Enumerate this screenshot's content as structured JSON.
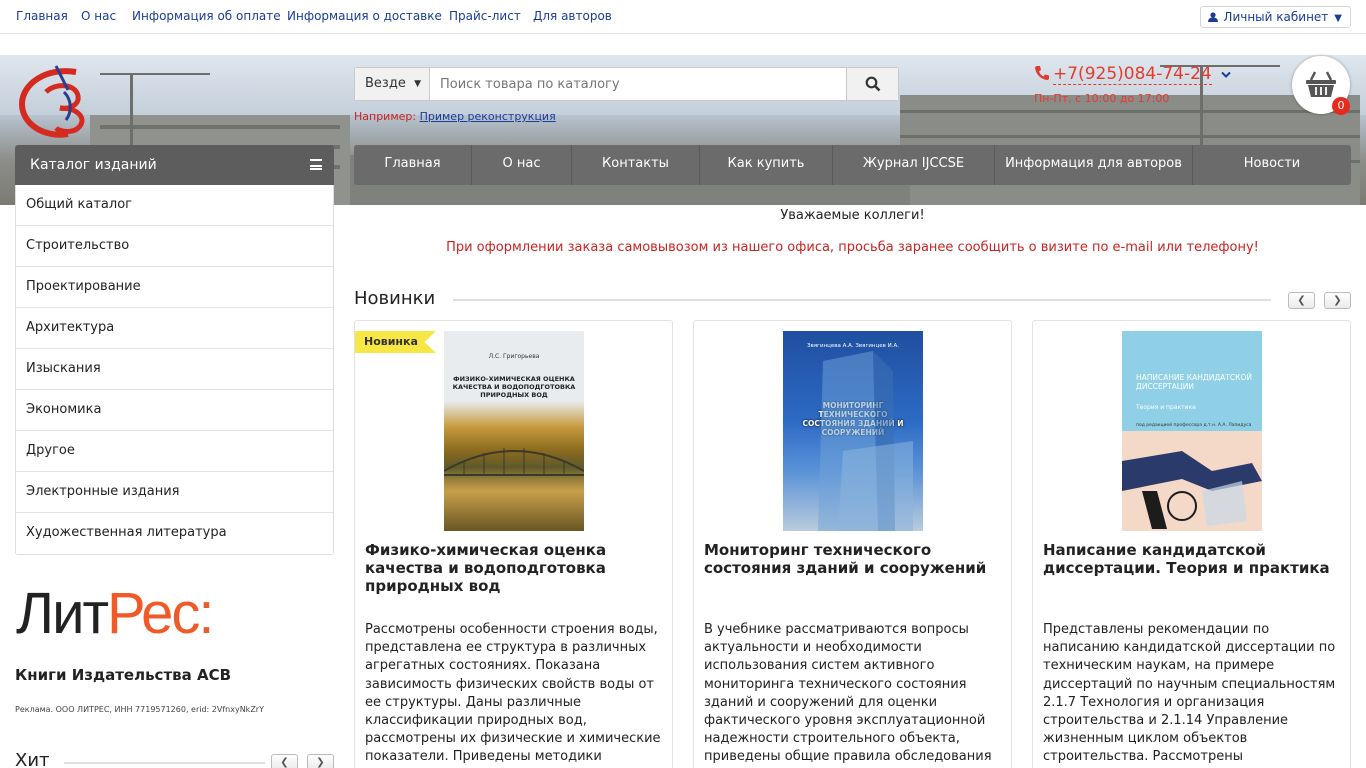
{
  "topnav": {
    "links": [
      "Главная",
      "О нас",
      "Информация об оплате",
      "Информация о доставке",
      "Прайс-лист",
      "Для авторов"
    ],
    "cabinet": "Личный кабинет"
  },
  "search": {
    "scope": "Везде",
    "placeholder": "Поиск товара по каталогу",
    "example_prefix": "Например:",
    "example_link": "Пример реконструкция"
  },
  "contact": {
    "phone": "+7(925)084-74-24",
    "hours": "Пн-Пт, с 10:00 до 17:00"
  },
  "cart": {
    "count": "0"
  },
  "mainnav": [
    "Главная",
    "О нас",
    "Контакты",
    "Как купить",
    "Журнал IJCCSE",
    "Информация для авторов",
    "Новости"
  ],
  "catalog": {
    "title": "Каталог изданий",
    "items": [
      "Общий каталог",
      "Строительство",
      "Проектирование",
      "Архитектура",
      "Изыскания",
      "Экономика",
      "Другое",
      "Электронные издания",
      "Художественная литература"
    ]
  },
  "litres": {
    "logo_lit": "Лит",
    "logo_res": "Рес:",
    "title": "Книги Издательства АСВ",
    "ad": "Реклама. ООО ЛИТРЕС, ИНН 7719571260, erid: 2VfnxyNkZrY"
  },
  "notices": {
    "greeting": "Уважаемые коллеги!",
    "pickup": "При оформлении заказа самовывозом из нашего офиса, просьба заранее сообщить о визите по e-mail или телефону!"
  },
  "sections": {
    "new": "Новинки",
    "hit": "Хит"
  },
  "products": [
    {
      "badge": "Новинка",
      "title": "Физико-химическая оценка качества и водоподготовка природных вод",
      "desc": "Рассмотрены особенности строения воды, представлена ее структура в различных агрегатных состояниях. Показана зависимость физических свойств воды от ее структуры. Даны различные классификации природных вод, рассмотрены их физические и химические показатели. Приведены методики определения основных хи..",
      "cover_author": "Л.С. Григорьева",
      "cover_title": "Физико-химическая оценка качества и водоподготовка природных вод"
    },
    {
      "badge": "",
      "title": "Мониторинг технического состояния зданий и сооружений",
      "desc": "В учебнике рассматриваются вопросы актуальности и необходимости использования систем активного мониторинга технического состояния зданий и сооружений для оценки фактического уровня эксплуатационной надежности строительного объекта, приведены общие правила обследования и мониторинга",
      "cover_author": "Звягинцева А.А.   Звягинцев И.А.",
      "cover_title": "Мониторинг технического состояния зданий и сооружений"
    },
    {
      "badge": "",
      "title": "Написание кандидатской диссертации. Теория и практика",
      "desc": "Представлены рекомендации по написанию кандидатской диссертации по техническим наукам, на примере диссертаций по научным специальностям 2.1.7 Технология и организация строительства и 2.1.14 Управление жизненным циклом объектов строительства. Рассмотрены теоретические аспекты, в соответствии с положе..",
      "cover_title": "Написание кандидатской диссертации",
      "cover_sub": "Теория и практика",
      "cover_editor": "под редакцией профессора д.т.н. А.А. Лапидуса"
    }
  ],
  "colors": {
    "nav_link": "#1a3c9a",
    "accent_red": "#e23b2e",
    "menu_bg": "#6b6b6b",
    "badge": "#f6e744",
    "litres_orange": "#f05a28"
  }
}
